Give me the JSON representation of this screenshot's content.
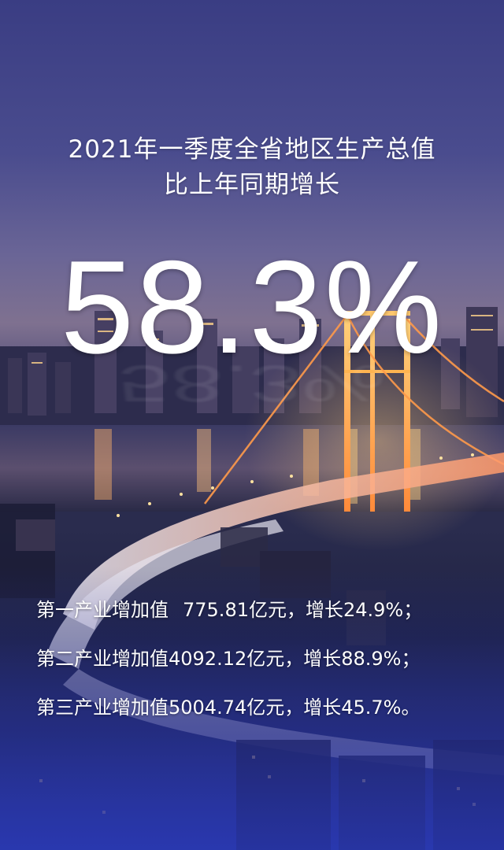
{
  "headline": {
    "line1": "2021年一季度全省地区生产总值",
    "line2": "比上年同期增长"
  },
  "growth": {
    "value": "58.3%"
  },
  "industries": [
    {
      "label": "第一产业增加值",
      "amount": "775.81亿元，",
      "growth": "增长24.9%；"
    },
    {
      "label": "第二产业增加值",
      "amount": "4092.12亿元，",
      "growth": "增长88.9%；"
    },
    {
      "label": "第三产业增加值",
      "amount": "5004.74亿元，",
      "growth": "增长45.7%。"
    }
  ],
  "colors": {
    "sky_top": "#3a3d83",
    "bridge_light": "#ffb347",
    "text": "#ffffff",
    "bottom_tint": "#2e3a98"
  }
}
